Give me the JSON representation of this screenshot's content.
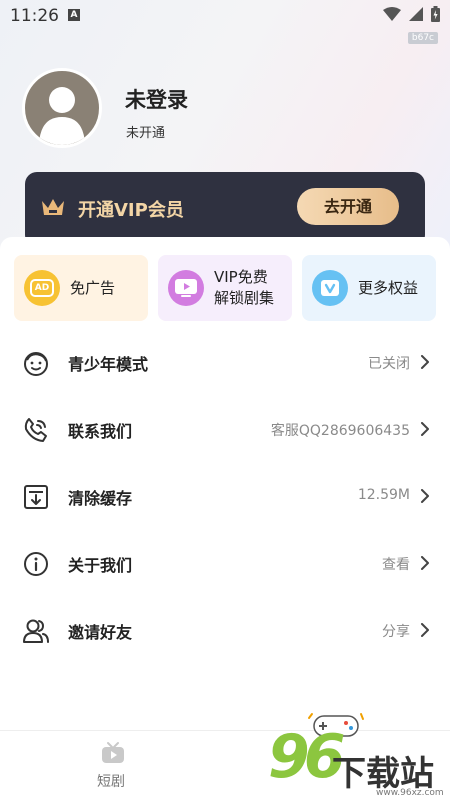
{
  "status_bar": {
    "time": "11:26",
    "notification_icon": "A",
    "build_tag": "b67c"
  },
  "profile": {
    "username": "未登录",
    "membership_status": "未开通"
  },
  "vip_banner": {
    "title": "开通VIP会员",
    "button_label": "去开通"
  },
  "features": [
    {
      "label": "免广告",
      "icon": "ad-icon",
      "icon_text": "AD",
      "bg": "#fff3e3",
      "icon_color": "#f7c233"
    },
    {
      "label_line1": "VIP免费",
      "label_line2": "解锁剧集",
      "icon": "tv-icon",
      "bg": "#f6eefc",
      "icon_color": "#d27ce0"
    },
    {
      "label": "更多权益",
      "icon": "vip-badge-icon",
      "bg": "#eaf4fd",
      "icon_color": "#66c1f3"
    }
  ],
  "menu": [
    {
      "label": "青少年模式",
      "value": "已关闭",
      "icon": "teen-face-icon"
    },
    {
      "label": "联系我们",
      "value": "客服QQ2869606435",
      "icon": "phone-chat-icon"
    },
    {
      "label": "清除缓存",
      "value": "12.59M",
      "icon": "clear-cache-icon"
    },
    {
      "label": "关于我们",
      "value": "查看",
      "icon": "info-icon"
    },
    {
      "label": "邀请好友",
      "value": "分享",
      "icon": "invite-friends-icon"
    }
  ],
  "bottom_nav": {
    "items": [
      {
        "label": "短剧",
        "icon": "tv-icon"
      }
    ]
  },
  "watermark": {
    "text": "下载站",
    "number": "96",
    "url": "www.96xz.com"
  }
}
